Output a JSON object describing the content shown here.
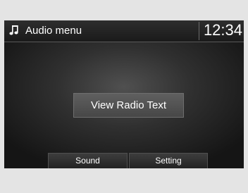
{
  "header": {
    "icon": "music-note-icon",
    "title": "Audio menu",
    "clock": "12:34"
  },
  "main": {
    "view_radio_text_label": "View Radio Text"
  },
  "softkeys": {
    "sound_label": "Sound",
    "setting_label": "Setting"
  }
}
